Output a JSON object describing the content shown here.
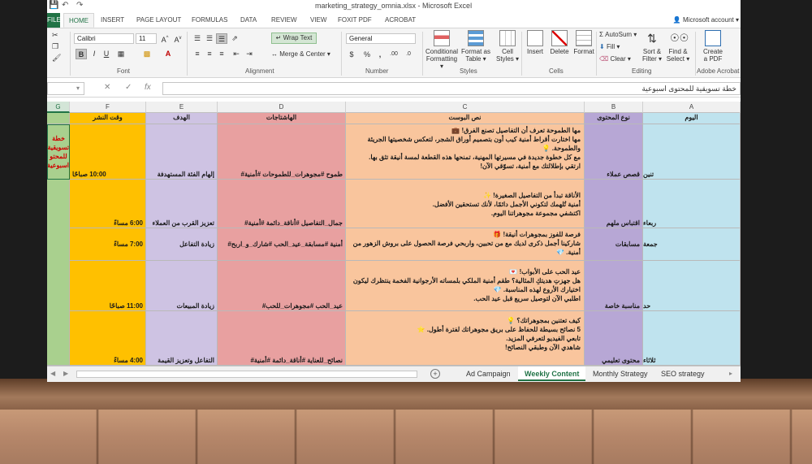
{
  "window": {
    "title": "marketing_strategy_omnia.xlsx - Microsoft Excel",
    "account": "Microsoft account"
  },
  "ribbon_tabs": [
    {
      "label": "FILE"
    },
    {
      "label": "HOME"
    },
    {
      "label": "INSERT"
    },
    {
      "label": "PAGE LAYOUT"
    },
    {
      "label": "FORMULAS"
    },
    {
      "label": "DATA"
    },
    {
      "label": "REVIEW"
    },
    {
      "label": "VIEW"
    },
    {
      "label": "FOXIT PDF"
    },
    {
      "label": "ACROBAT"
    }
  ],
  "ribbon": {
    "font_name": "Calibri",
    "font_size": "11",
    "wrap_text": "Wrap Text",
    "merge_center": "Merge & Center",
    "number_format": "General",
    "groups": {
      "font": "Font",
      "alignment": "Alignment",
      "number": "Number",
      "styles": "Styles",
      "cells": "Cells",
      "editing": "Editing",
      "adobe": "Adobe Acrobat"
    },
    "buttons": {
      "conditional": [
        "Conditional",
        "Formatting ▾"
      ],
      "format_table": [
        "Format as",
        "Table ▾"
      ],
      "cell_styles": [
        "Cell",
        "Styles ▾"
      ],
      "insert": "Insert",
      "delete": "Delete",
      "format": "Format",
      "autosum": "AutoSum ▾",
      "fill": "Fill ▾",
      "clear": "Clear ▾",
      "sort": [
        "Sort &",
        "Filter ▾"
      ],
      "find": [
        "Find &",
        "Select ▾"
      ],
      "create_pdf": [
        "Create",
        "a PDF"
      ]
    }
  },
  "formula_bar": {
    "content": "خطة تسويقية للمحتوى اسبوعية"
  },
  "columns": {
    "G": "G",
    "F": "F",
    "E": "E",
    "D": "D",
    "C": "C",
    "B": "B",
    "A": "A"
  },
  "headers": {
    "F": "وقت النشر",
    "E": "الهدف",
    "D": "الهاشتاجات",
    "C": "نص البوست",
    "B": "نوع المحتوى",
    "A": "اليوم"
  },
  "g_cell": [
    "خطة",
    "تسويقية",
    "للمحتو",
    "اسبوعية"
  ],
  "rows": [
    {
      "A": "تنين",
      "B": "قصص عملاء",
      "C": [
        "مها الطموحة تعرف أن التفاصيل تصنع الفرق! 💼",
        "مها اختارت أقراط أمنية كيب أون بتصميم أوراق الشجر، لتعكس شخصيتها الجريئة والطموحة. 💡",
        "مع كل خطوة جديدة في مسيرتها المهنية، تمنحها هذه القطعة لمسة أنيقة تثق بها.",
        "ارتقي بإطلالتك مع أمنية، تسوّقي الآن!"
      ],
      "D": "طموح #مجوهرات_للطموحات #أمنية#",
      "E": "إلهام الفئة المستهدفة",
      "F": "10:00 صباحًا"
    },
    {
      "A": "ربعاء",
      "B": "اقتباس ملهم",
      "C": [
        "الأناقة تبدأ من التفاصيل الصغيرة! ✨",
        "أمنية تُلهمك لتكوني الأجمل دائمًا، لأنك تستحقين الأفضل.",
        "اكتشفي مجموعة مجوهراتنا اليوم."
      ],
      "D": "جمال_التفاصيل #أناقة_دائمة #أمنية#",
      "E": "تعزيز القرب من العملاء",
      "F": "6:00 مساءً"
    },
    {
      "A": "جمعة",
      "B": "مسابقات",
      "C": [
        "فرصة للفوز بمجوهرات أنيقة! 🎁",
        "شاركينا أجمل ذكرى لديك مع من تحبين، واربحي فرصة الحصول على بروش الزهور من أمنية. 💎"
      ],
      "D": "أمنية #مسابقة_عيد_الحب #شارك_و_اربح#",
      "E": "زيادة التفاعل",
      "F": "7:00 مساءً"
    },
    {
      "A": "حد",
      "B": "مناسبة خاصة",
      "C": [
        "عيد الحب على الأبواب! 💌",
        "هل جهزتِ هديتكِ المثالية؟ طقم أمنية الملكي بلمساته الأرجوانية الفخمة ينتظرك ليكون اختيارك الأروع لهذه المناسبة. 💎",
        "اطلبي الآن لتوصيل سريع قبل عيد الحب."
      ],
      "D": "عيد_الحب #مجوهرات_للحب#",
      "E": "زيادة المبيعات",
      "F": "11:00 صباحًا"
    },
    {
      "A": "ثلاثاء",
      "B": "محتوى تعليمي",
      "C": [
        "كيف تعتنين بمجوهراتك؟ 💡",
        "5 نصائح بسيطة للحفاظ على بريق مجوهراتك لفترة أطول. ⭐",
        "تابعي الفيديو لتعرفي المزيد.",
        "شاهدي الآن وطبقي النصائح!"
      ],
      "D": "نصائح_للعناية #أناقة_دائمة #أمنية#",
      "E": "التفاعل وتعزيز القيمة",
      "F": "4:00 مساءً"
    }
  ],
  "sheet_tabs": [
    {
      "label": "Ad Campaign"
    },
    {
      "label": "Weekly Content"
    },
    {
      "label": "Monthly Strategy"
    },
    {
      "label": "SEO strategy"
    }
  ],
  "colors": {
    "excel_green": "#217346",
    "colA": "#bfe3ee",
    "colB": "#b7a7d5",
    "colC": "#f9c59d",
    "colD": "#e8a0a0",
    "colE": "#cec3e3",
    "colF": "#ffc000",
    "colG": "#a9d08e"
  }
}
